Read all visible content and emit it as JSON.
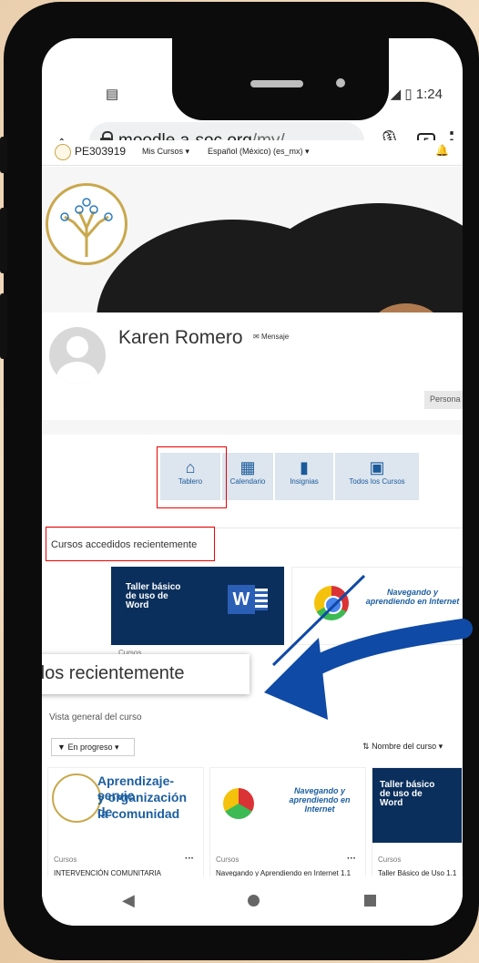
{
  "status": {
    "left_icon": "news-icon",
    "time": "1:24"
  },
  "browser": {
    "url_host": "moodle.a-soc.org",
    "url_path": "/my/",
    "tabs_count": "5"
  },
  "moodle_nav": {
    "user_code": "PE303919",
    "courses_menu": "Mis Cursos ▾",
    "language": "Español (México) (es_mx) ▾"
  },
  "profile": {
    "name": "Karen Romero",
    "message_label": "Mensaje",
    "personal_btn": "Persona"
  },
  "quick_links": [
    {
      "label": "Tablero",
      "icon": "home-icon"
    },
    {
      "label": "Calendario",
      "icon": "calendar-icon"
    },
    {
      "label": "Insignias",
      "icon": "bookmark-icon"
    },
    {
      "label": "Todos los Cursos",
      "icon": "book-icon"
    }
  ],
  "recent": {
    "title": "Cursos accedidos recientemente",
    "cards": [
      {
        "image_title": "Taller básico de uso de Word",
        "category": "Cursos"
      },
      {
        "image_title": "Navegando y aprendiendo en Internet",
        "category": ""
      }
    ]
  },
  "callout": {
    "text": "dos recientemente"
  },
  "overview": {
    "title": "Vista general del curso",
    "filter": "En progreso ▾",
    "sort": "Nombre del curso ▾",
    "courses": [
      {
        "image_line1": "Aprendizaje-servic",
        "image_line2": "y organización de",
        "image_line3": "la comunidad",
        "category": "Cursos",
        "name": "INTERVENCIÓN COMUNITARIA"
      },
      {
        "image_title": "Navegando y aprendiendo en Internet",
        "category": "Cursos",
        "name": "Navegando y Aprendiendo en Internet 1.1"
      },
      {
        "image_title": "Taller básico de uso de Word",
        "category": "Cursos",
        "name": "Taller Básico de Uso 1.1"
      }
    ]
  },
  "colors": {
    "arrow": "#0f4aa6",
    "highlight": "#e00000",
    "quick_bg": "#dde5ee",
    "quick_fg": "#1a5a9a"
  }
}
